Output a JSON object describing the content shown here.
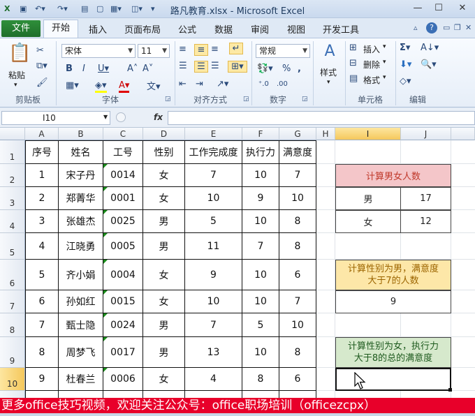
{
  "window": {
    "title": "路凡教育.xlsx  -  Microsoft Excel"
  },
  "ribbon": {
    "file_tab": "文件",
    "tabs": [
      "开始",
      "插入",
      "页面布局",
      "公式",
      "数据",
      "审阅",
      "视图",
      "开发工具"
    ],
    "groups": {
      "clipboard": "剪贴板",
      "font": "字体",
      "alignment": "对齐方式",
      "number": "数字",
      "cells": "单元格",
      "editing": "编辑"
    },
    "paste_label": "粘贴",
    "styles_label": "样式",
    "font_name": "宋体",
    "font_size": "11",
    "number_format": "常规",
    "insert_label": "插入",
    "delete_label": "删除",
    "format_label": "格式"
  },
  "formula_bar": {
    "name_box": "I10",
    "fx": "fx",
    "value": ""
  },
  "columns": [
    "A",
    "B",
    "C",
    "D",
    "E",
    "F",
    "G",
    "H",
    "I",
    "J"
  ],
  "rows": [
    "1",
    "2",
    "3",
    "4",
    "5",
    "6",
    "7",
    "8",
    "9",
    "10"
  ],
  "table": {
    "headers": [
      "序号",
      "姓名",
      "工号",
      "性别",
      "工作完成度",
      "执行力",
      "满意度"
    ],
    "data": [
      [
        "1",
        "宋子丹",
        "0014",
        "女",
        "7",
        "10",
        "7"
      ],
      [
        "2",
        "郑菁华",
        "0001",
        "女",
        "10",
        "9",
        "10"
      ],
      [
        "3",
        "张雄杰",
        "0025",
        "男",
        "5",
        "10",
        "8"
      ],
      [
        "4",
        "江晓勇",
        "0005",
        "男",
        "11",
        "7",
        "8"
      ],
      [
        "5",
        "齐小娟",
        "0004",
        "女",
        "9",
        "10",
        "6"
      ],
      [
        "6",
        "孙如红",
        "0015",
        "女",
        "10",
        "10",
        "7"
      ],
      [
        "7",
        "甄士隐",
        "0024",
        "男",
        "7",
        "5",
        "10"
      ],
      [
        "8",
        "周梦飞",
        "0017",
        "男",
        "13",
        "10",
        "8"
      ],
      [
        "9",
        "杜春兰",
        "0006",
        "女",
        "4",
        "8",
        "6"
      ]
    ]
  },
  "side": {
    "count_title": "计算男女人数",
    "male_label": "男",
    "male_count": "17",
    "female_label": "女",
    "female_count": "12",
    "q2_title_line1": "计算性别为男，满意度",
    "q2_title_line2": "大于7的人数",
    "q2_result": "9",
    "q3_title_line1": "计算性别为女，执行力",
    "q3_title_line2": "大于8的总的满意度",
    "q3_result": ""
  },
  "banner": "更多office技巧视频，欢迎关注公众号：office职场培训（officezcpx）",
  "colors": {
    "pink": "#f4c6c9",
    "yellow": "#fde7a8",
    "green": "#d6e9cc",
    "banner": "#e8002a",
    "file_tab": "#2a8a36"
  }
}
